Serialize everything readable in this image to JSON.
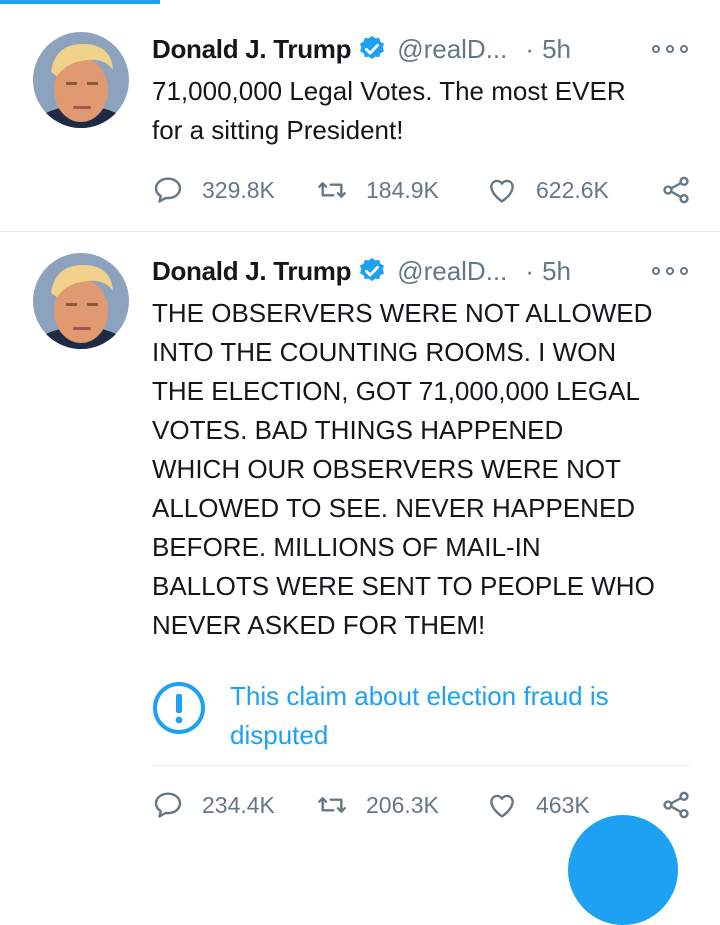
{
  "tweets": [
    {
      "name": "Donald J. Trump",
      "handle": "@realD...",
      "separator": "·",
      "time": "5h",
      "text": "71,000,000 Legal Votes. The most EVER\nfor a sitting President!",
      "replies": "329.8K",
      "retweets": "184.9K",
      "likes": "622.6K"
    },
    {
      "name": "Donald J. Trump",
      "handle": "@realD...",
      "separator": "·",
      "time": "5h",
      "text": "THE OBSERVERS WERE NOT ALLOWED\nINTO THE COUNTING ROOMS. I WON\nTHE ELECTION, GOT 71,000,000 LEGAL\nVOTES. BAD THINGS HAPPENED\nWHICH OUR OBSERVERS WERE NOT\nALLOWED TO SEE. NEVER HAPPENED\nBEFORE. MILLIONS OF MAIL-IN\nBALLOTS WERE SENT TO PEOPLE WHO\nNEVER ASKED FOR THEM!",
      "notice": "This claim about election fraud is\ndisputed",
      "replies": "234.4K",
      "retweets": "206.3K",
      "likes": "463K"
    }
  ],
  "icons": {
    "verified": "verified-badge-icon",
    "more": "more-options-icon",
    "reply": "reply-icon",
    "retweet": "retweet-icon",
    "like": "like-icon",
    "share": "share-icon",
    "notice": "info-icon"
  },
  "colors": {
    "accent": "#1da1f2",
    "secondary_text": "#657786",
    "primary_text": "#14171a",
    "divider": "#e6ecf0"
  }
}
